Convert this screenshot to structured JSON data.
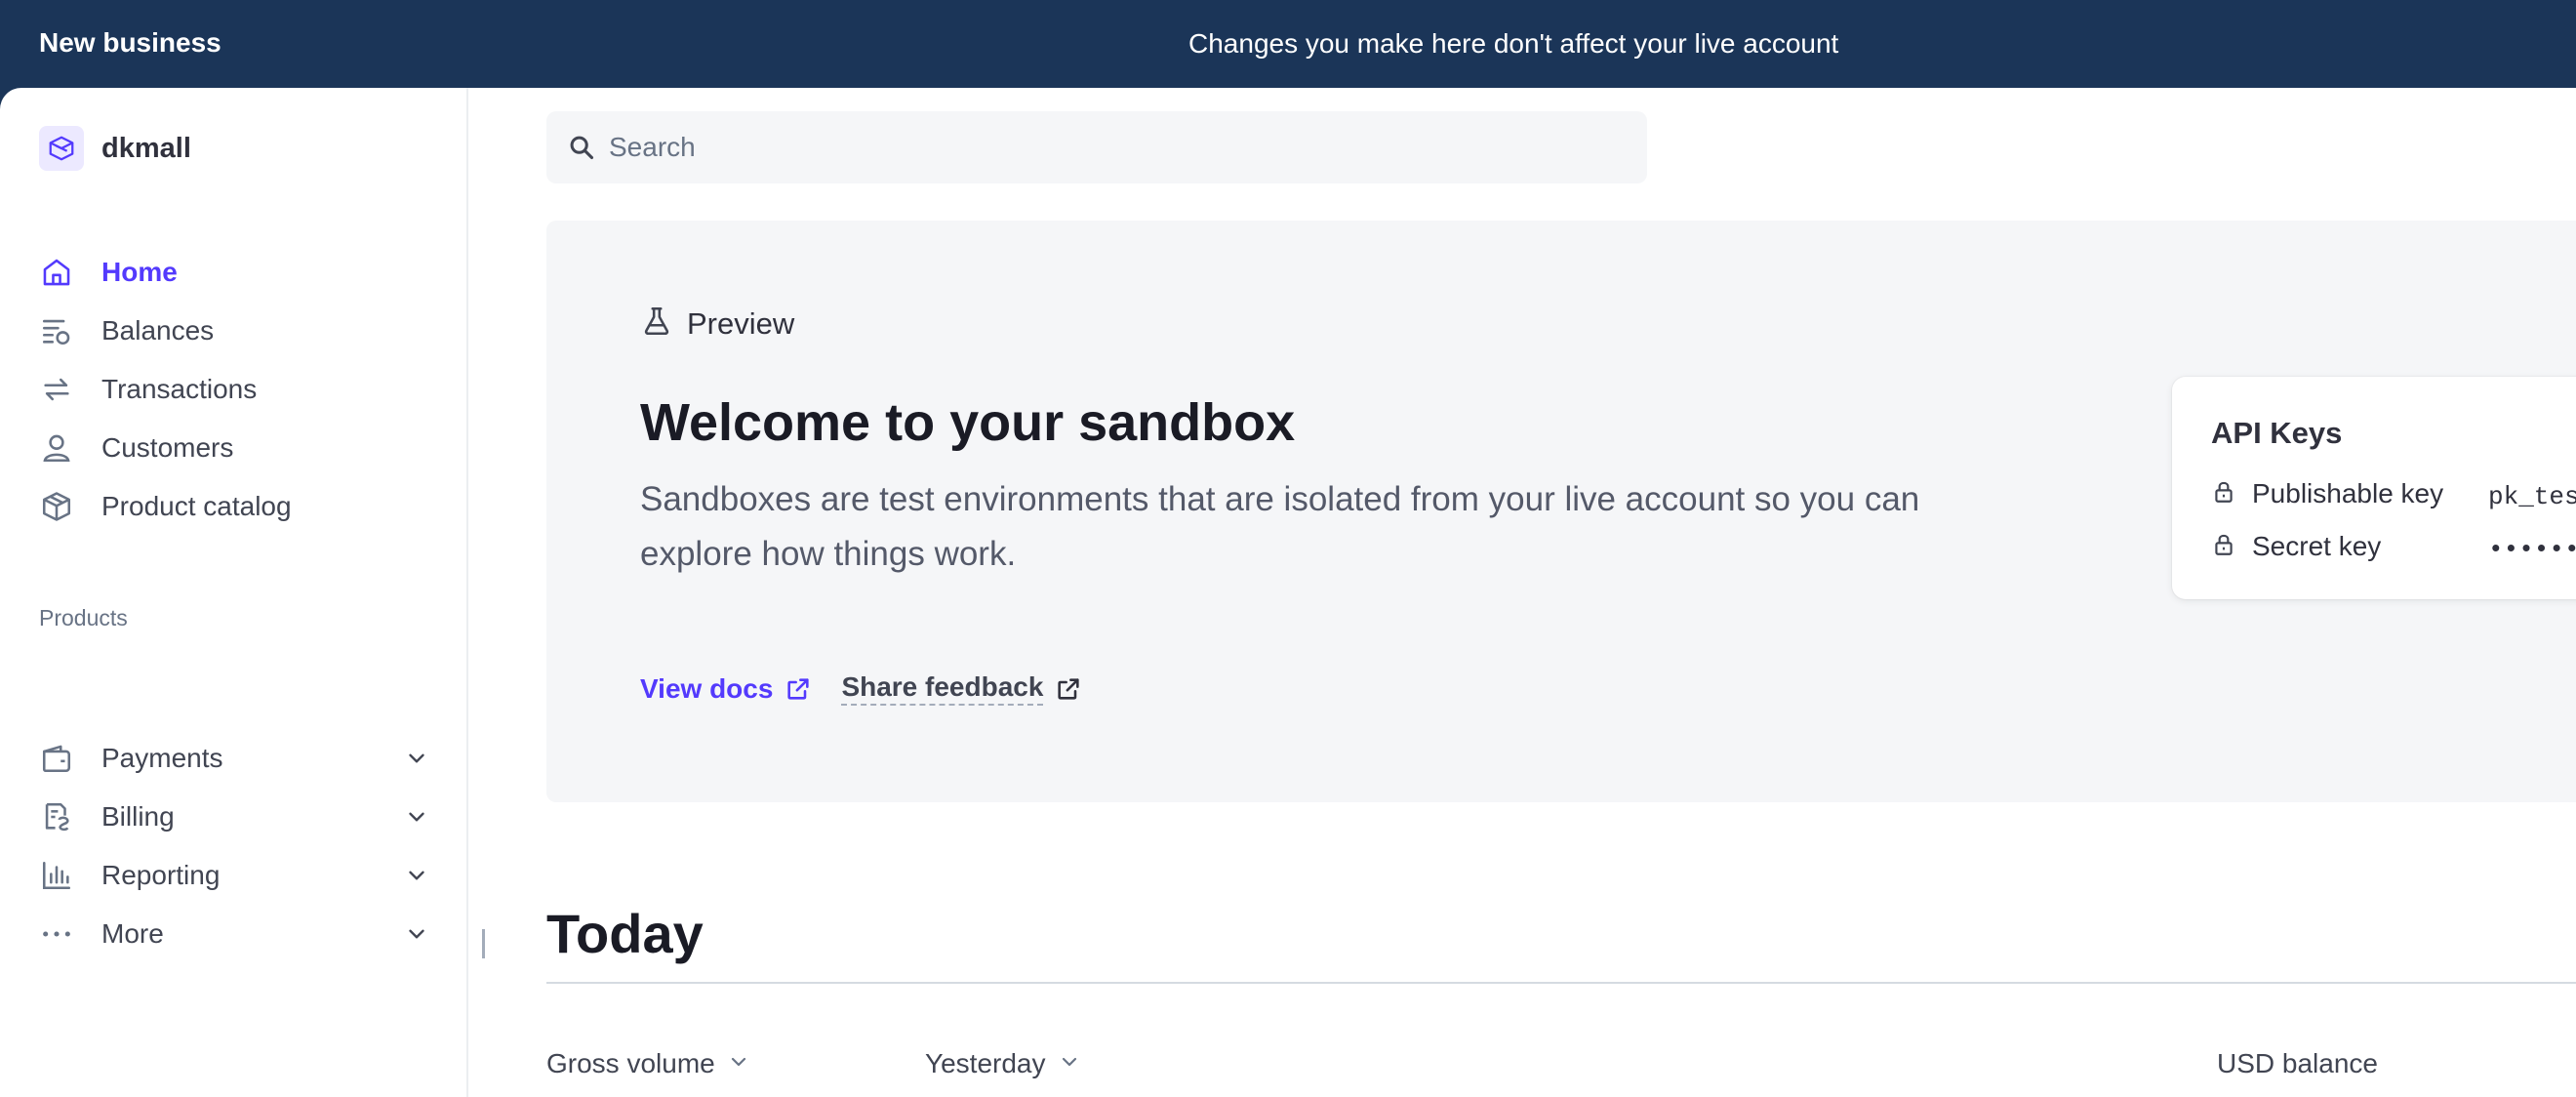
{
  "banner": {
    "business_name": "New business",
    "notice": "Changes you make here don't affect your live account"
  },
  "account": {
    "name": "dkmall"
  },
  "nav": {
    "primary": [
      {
        "label": "Home",
        "icon": "home-icon",
        "active": true
      },
      {
        "label": "Balances",
        "icon": "balances-icon",
        "active": false
      },
      {
        "label": "Transactions",
        "icon": "transactions-icon",
        "active": false
      },
      {
        "label": "Customers",
        "icon": "person-icon",
        "active": false
      },
      {
        "label": "Product catalog",
        "icon": "box-icon",
        "active": false
      }
    ],
    "section_label": "Products",
    "products": [
      {
        "label": "Payments",
        "icon": "wallet-icon"
      },
      {
        "label": "Billing",
        "icon": "billing-icon"
      },
      {
        "label": "Reporting",
        "icon": "bar-chart-icon"
      },
      {
        "label": "More",
        "icon": "more-dots-icon"
      }
    ]
  },
  "search": {
    "placeholder": "Search"
  },
  "sandbox": {
    "preview_label": "Preview",
    "title": "Welcome to your sandbox",
    "description": "Sandboxes are test environments that are isolated from your live account so you can explore how things work.",
    "view_docs": "View docs",
    "share_feedback": "Share feedback"
  },
  "api_keys": {
    "title": "API Keys",
    "publishable_label": "Publishable key",
    "publishable_value": "pk_tes",
    "secret_label": "Secret key",
    "secret_value": "•••••••"
  },
  "today": {
    "title": "Today",
    "gross_volume": "Gross volume",
    "comparison": "Yesterday",
    "usd_balance": "USD balance"
  },
  "colors": {
    "banner_bg": "#1b3558",
    "accent": "#533afd",
    "panel_bg": "#f5f6f8"
  }
}
